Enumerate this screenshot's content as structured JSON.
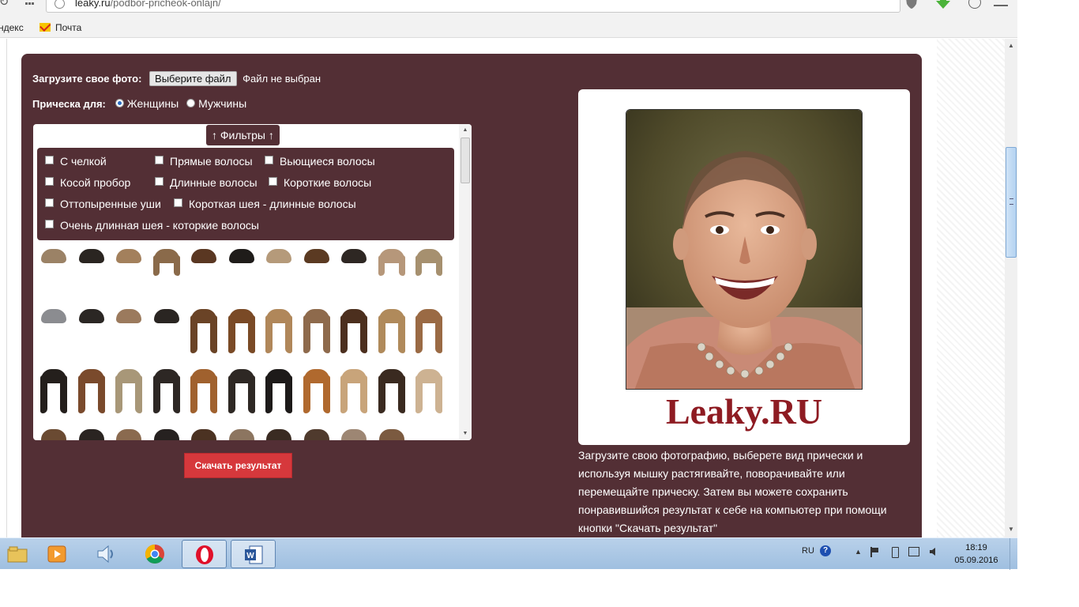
{
  "browser": {
    "url_host": "leaky.ru",
    "url_path": "/podbor-pricheok-onlajn/",
    "bookmarks": [
      {
        "label": "ндекс"
      },
      {
        "label": "Почта"
      }
    ]
  },
  "form": {
    "upload_label": "Загрузите свое фото:",
    "file_button_label": "Выберите файл",
    "file_status": "Файл не выбран",
    "gender_label": "Прическа для:",
    "gender_options": [
      {
        "label": "Женщины",
        "selected": true
      },
      {
        "label": "Мужчины",
        "selected": false
      }
    ]
  },
  "filters": {
    "toggle_label": "↑ Фильтры ↑",
    "items": [
      {
        "label": "С челкой",
        "checked": false
      },
      {
        "label": "Прямые волосы",
        "checked": false
      },
      {
        "label": "Вьющиеся волосы",
        "checked": false
      },
      {
        "label": "Косой пробор",
        "checked": false
      },
      {
        "label": "Длинные волосы",
        "checked": false
      },
      {
        "label": "Короткие волосы",
        "checked": false
      },
      {
        "label": "Оттопыренные уши",
        "checked": false
      },
      {
        "label": "Короткая шея - длинные волосы",
        "checked": false
      },
      {
        "label": "Очень длинная шея - которкие волосы",
        "checked": false
      }
    ]
  },
  "hairstyle_colors": [
    "#9b8266",
    "#2a2521",
    "#a3805c",
    "#8a6a4a",
    "#5a3722",
    "#1f1c1a",
    "#b59a7a",
    "#5b3a22",
    "#2e2723",
    "#b6977a",
    "#a6906f",
    "#8b8c90",
    "#2b2724",
    "#9b7a5d",
    "#2a2522",
    "#6a4326",
    "#7a4a26",
    "#b0875a",
    "#8e6a4c",
    "#4c2f1e",
    "#b08a5b",
    "#9a6a44",
    "#241f1c",
    "#7a4a2c",
    "#a89778",
    "#2d2724",
    "#a0612e",
    "#2e2824",
    "#1d1a19",
    "#b0692e",
    "#c8a47a",
    "#3a2a20",
    "#cdb292",
    "#6a4a32",
    "#2a2421",
    "#8a6a4f",
    "#262120",
    "#4b3222",
    "#8c7560",
    "#3a2b22",
    "#4f3a2d",
    "#9d8673",
    "#7b5a40"
  ],
  "download_button_label": "Скачать результат",
  "watermark": "Leaky.RU",
  "description": "Загрузите свою фотографию, выберете вид прически и используя мышку растягивайте, поворачивайте или перемещайте прическу. Затем вы можете сохранить понравившийся результат к себе на компьютер при помощи кнопки \"Скачать результат\"",
  "taskbar": {
    "language": "RU",
    "time": "18:19",
    "date": "05.09.2016"
  },
  "colors": {
    "panel_bg": "#532f35",
    "button_red": "#d6383c",
    "watermark": "#8e1b22"
  }
}
